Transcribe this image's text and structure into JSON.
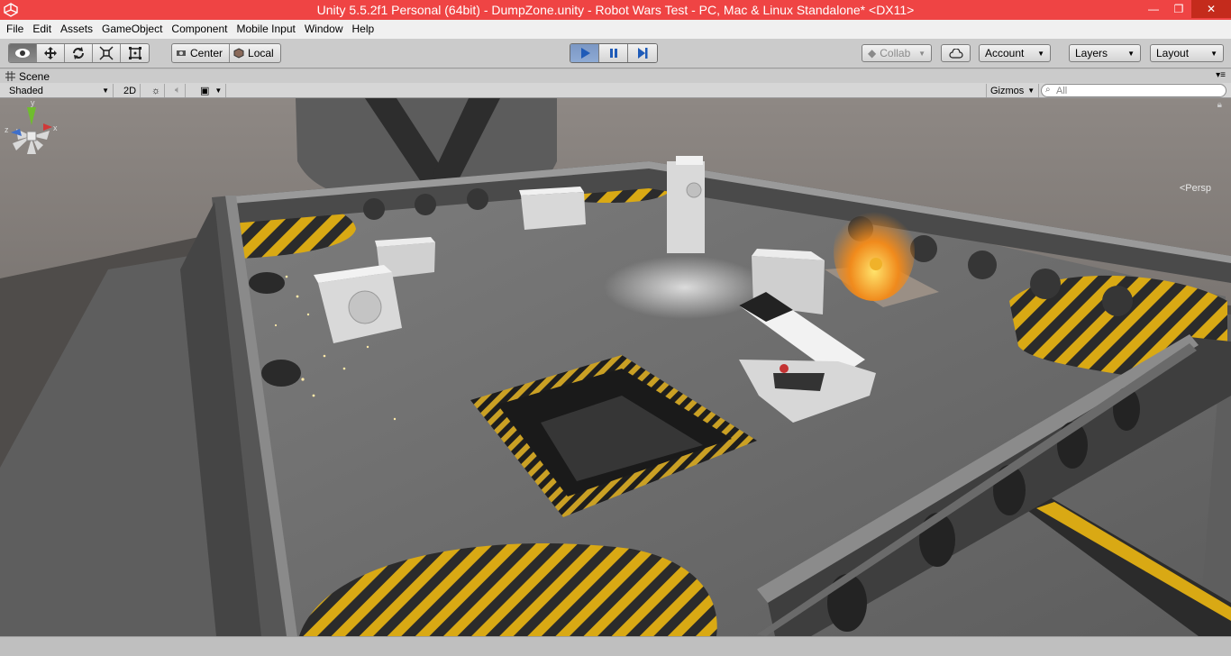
{
  "window": {
    "title": "Unity 5.5.2f1 Personal (64bit) - DumpZone.unity - Robot Wars Test - PC, Mac & Linux Standalone* <DX11>",
    "minimize": "—",
    "maximize": "❐",
    "close": "✕"
  },
  "menu": [
    "File",
    "Edit",
    "Assets",
    "GameObject",
    "Component",
    "Mobile Input",
    "Window",
    "Help"
  ],
  "toolbar": {
    "pivot_center": "Center",
    "pivot_local": "Local",
    "collab": "Collab",
    "account": "Account",
    "layers": "Layers",
    "layout": "Layout"
  },
  "scene": {
    "tab_label": "Scene",
    "shading": "Shaded",
    "mode_2d": "2D",
    "gizmos": "Gizmos",
    "search_placeholder": "All",
    "persp": "Persp",
    "gizmo_axes": {
      "y": "y",
      "x": "x",
      "z": "z"
    }
  },
  "colors": {
    "titlebar": "#ef4444",
    "play_active": "#7a97c4",
    "hazard_yellow": "#d9a914"
  }
}
